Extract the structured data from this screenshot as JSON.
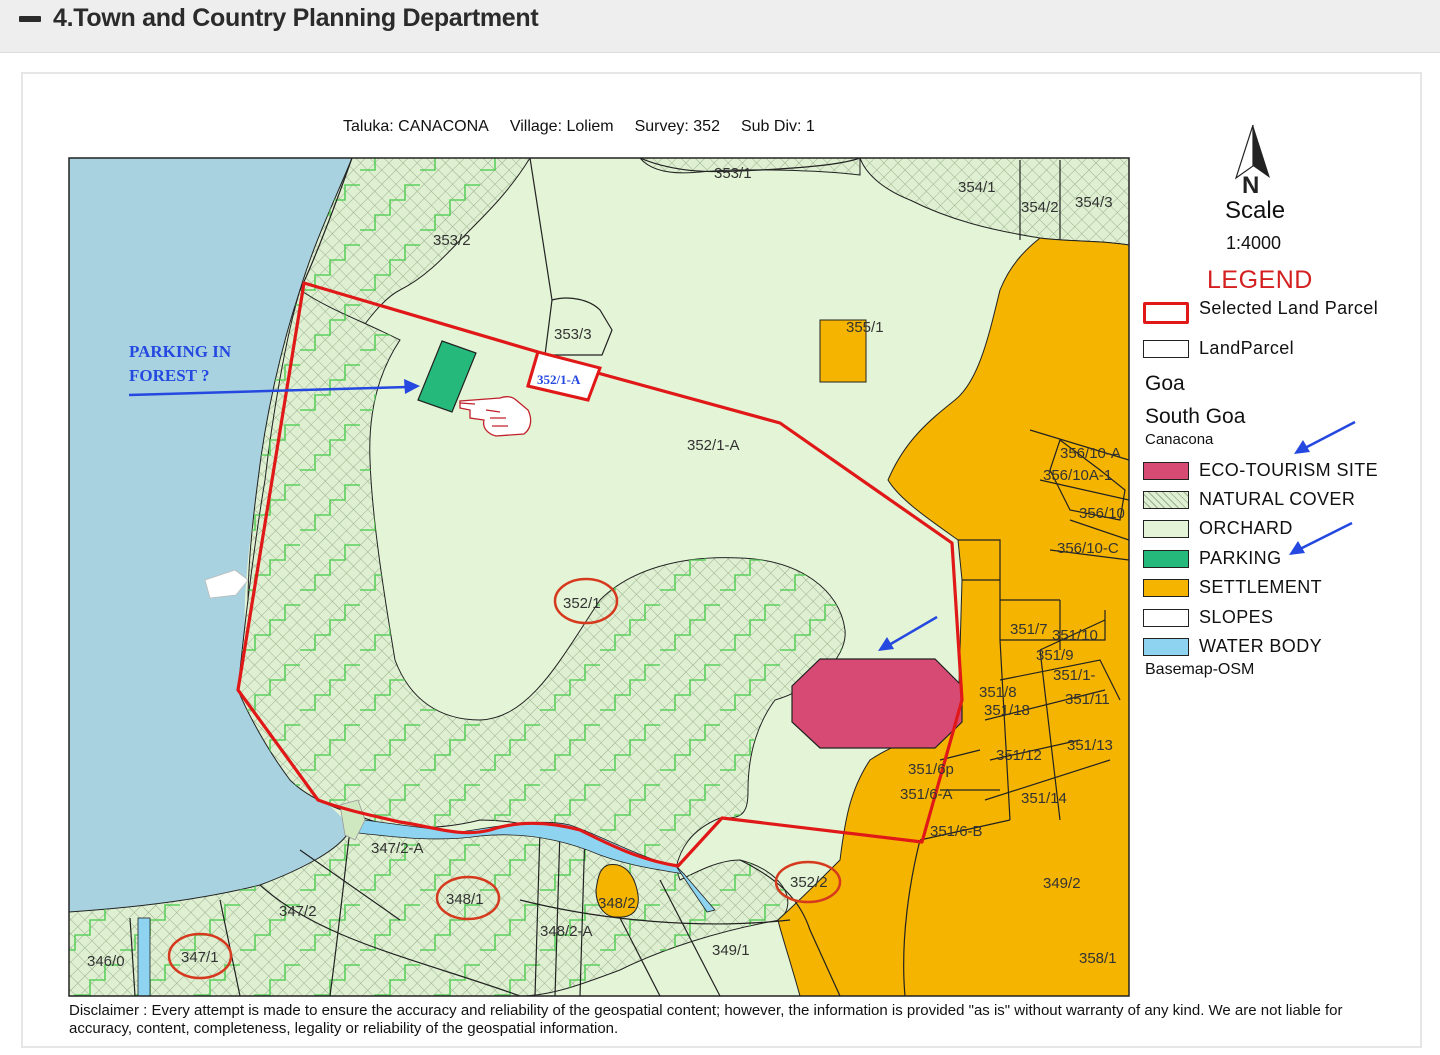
{
  "header": {
    "title": "4.Town and Country Planning Department"
  },
  "map_meta": {
    "taluka": "Taluka: CANACONA",
    "village": "Village: Loliem",
    "survey": "Survey: 352",
    "subdiv": "Sub Div: 1"
  },
  "north_arrow": {
    "letter": "N"
  },
  "scale": {
    "title": "Scale",
    "value": "1:4000"
  },
  "legend": {
    "title": "LEGEND",
    "items": [
      {
        "label": "Selected Land Parcel",
        "fill": "#ffffff",
        "stroke": "#e01818"
      },
      {
        "label": "LandParcel",
        "fill": "#ffffff",
        "stroke": "#222222"
      },
      {
        "label": "ECO-TOURISM SITE",
        "fill": "#d64a74",
        "stroke": "#222222"
      },
      {
        "label": "NATURAL COVER",
        "fill": "#dff0d2",
        "stroke": "#222222"
      },
      {
        "label": "ORCHARD",
        "fill": "#e4f4d6",
        "stroke": "#222222"
      },
      {
        "label": "PARKING",
        "fill": "#25b97b",
        "stroke": "#222222"
      },
      {
        "label": "SETTLEMENT",
        "fill": "#f5b400",
        "stroke": "#222222"
      },
      {
        "label": "SLOPES",
        "fill": "#ffffff",
        "stroke": "#222222"
      },
      {
        "label": "WATER BODY",
        "fill": "#8ed4f0",
        "stroke": "#222222"
      }
    ],
    "state": "Goa",
    "district": "South Goa",
    "taluka": "Canacona",
    "basemap": "Basemap-OSM"
  },
  "annotation": {
    "line1": "PARKING IN",
    "line2": "FOREST ?"
  },
  "parcel_labels": {
    "p353_1": "353/1",
    "p354_1": "354/1",
    "p354_2": "354/2",
    "p354_3": "354/3",
    "p353_2": "353/2",
    "p353_3": "353/3",
    "p355_1": "355/1",
    "p352_1A_small": "352/1-A",
    "p352_1A": "352/1-A",
    "p356_10A": "356/10-A",
    "p356_10A1": "356/10A-1",
    "p356_10": "356/10",
    "p356_10C": "356/10-C",
    "p352_1": "352/1",
    "p351_7": "351/7",
    "p351_10": "351/10",
    "p351_9": "351/9",
    "p351_1": "351/1-",
    "p351_8": "351/8",
    "p351_18": "351/18",
    "p351_11": "351/11",
    "p351_12": "351/12",
    "p351_13": "351/13",
    "p351_6p": "351/6p",
    "p351_6A": "351/6-A",
    "p351_14": "351/14",
    "p351_6B": "351/6-B",
    "p347_2A": "347/2-A",
    "p352_2": "352/2",
    "p349_2": "349/2",
    "p348_1": "348/1",
    "p348_2": "348/2",
    "p347_2": "347/2",
    "p348_2A": "348/2-A",
    "p349_1": "349/1",
    "p346_0": "346/0",
    "p347_1": "347/1",
    "p358_1": "358/1"
  },
  "colors": {
    "water": "#a8d2df",
    "orchard": "#e4f4d6",
    "natural": "#dff0d2",
    "settlement": "#f5b400",
    "parking": "#25b97b",
    "eco": "#d64a74",
    "selected": "#e01818",
    "annotation": "#2448e0"
  },
  "icons": {
    "collapse": "minus-icon",
    "pointer": "pointing-hand-icon",
    "north": "north-arrow-icon"
  },
  "disclaimer": "Disclaimer : Every attempt is made to ensure the accuracy and reliability of the geospatial content; however, the information is provided \"as is\" without warranty of any kind. We are not liable for accuracy, content, completeness, legality or reliability of the geospatial information."
}
